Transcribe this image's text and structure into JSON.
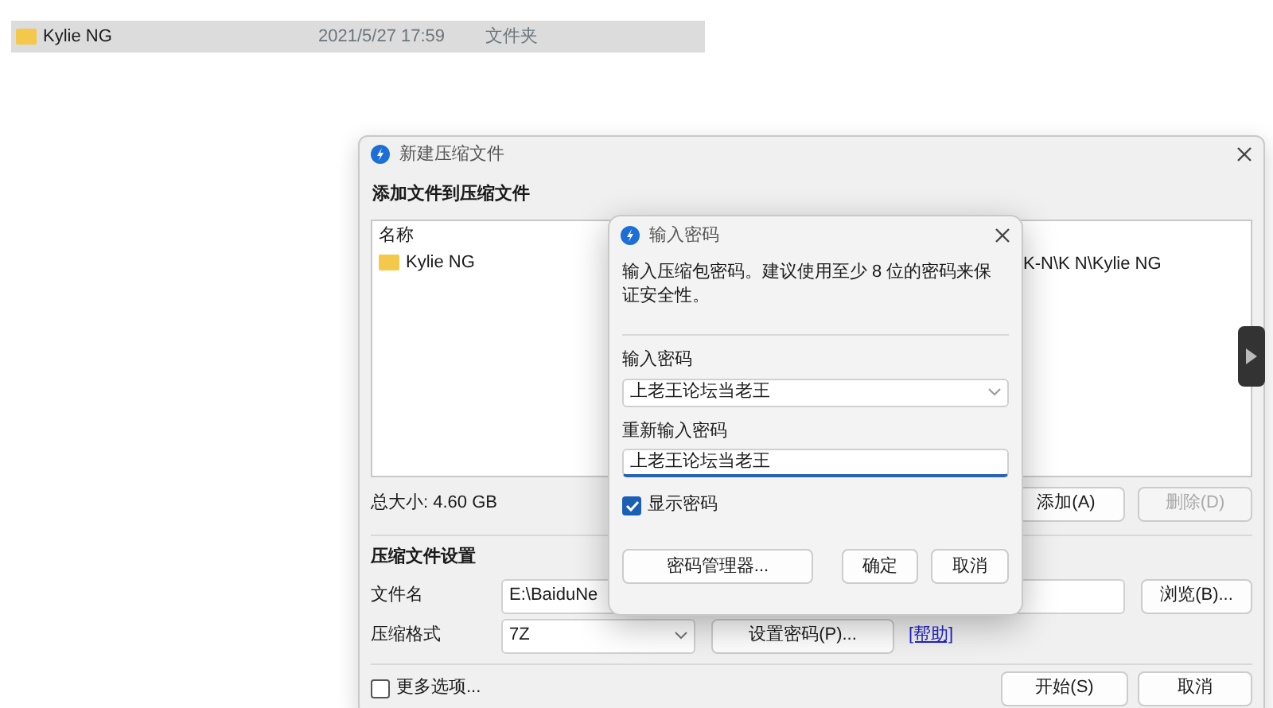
{
  "explorer_row": {
    "name": "Kylie NG",
    "modified": "2021/5/27 17:59",
    "type": "文件夹",
    "selected": true
  },
  "archive_dialog": {
    "title": "新建压缩文件",
    "add_section": "添加文件到压缩文件",
    "list": {
      "column_1": "名称",
      "items": [
        {
          "name": "Kylie NG",
          "path": "K-N\\K N\\Kylie NG"
        }
      ]
    },
    "total_size": "总大小: 4.60 GB",
    "add_button": {
      "label": "添加(A)",
      "disabled": false
    },
    "remove_button": {
      "label": "删除(D)",
      "disabled": true
    },
    "settings_section": "压缩文件设置",
    "filename_label": "文件名",
    "filename_value": "E:\\BaiduNe",
    "browse_button": "浏览(B)...",
    "format_label": "压缩格式",
    "format_value": "7Z",
    "set_password_button": "设置密码(P)...",
    "help_link": "[帮助]",
    "more_options": {
      "label": "更多选项...",
      "checked": false
    },
    "start_button": "开始(S)",
    "cancel_button": "取消"
  },
  "password_dialog": {
    "title": "输入密码",
    "description": "输入压缩包密码。建议使用至少 8 位的密码来保证安全性。",
    "password_label": "输入密码",
    "password_value": "上老王论坛当老王",
    "reenter_label": "重新输入密码",
    "reenter_value": "上老王论坛当老王",
    "show_password": {
      "label": "显示密码",
      "checked": true
    },
    "manager_button": "密码管理器...",
    "ok_button": "确定",
    "cancel_button": "取消"
  }
}
